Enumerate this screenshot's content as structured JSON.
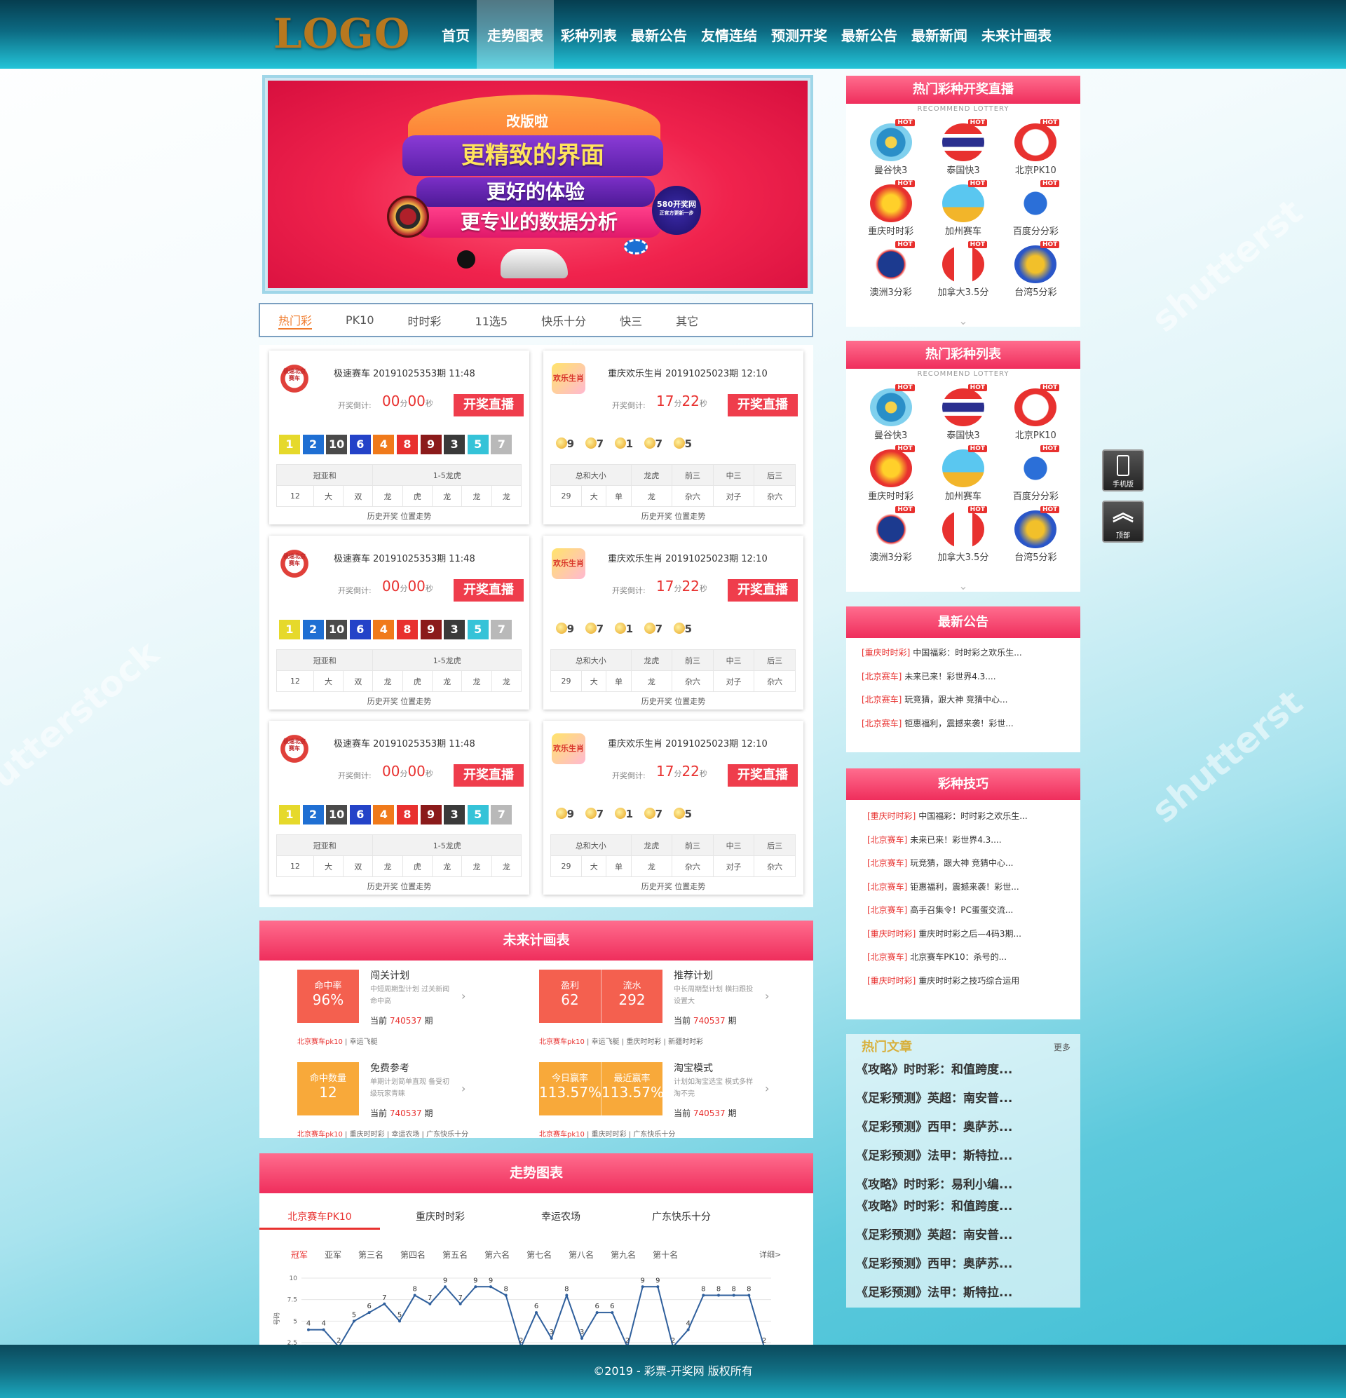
{
  "header": {
    "logo": "LOGO",
    "nav": [
      "首页",
      "走势图表",
      "彩种列表",
      "最新公告",
      "友情连结",
      "预测开奖",
      "最新公告",
      "最新新闻",
      "未来计画表"
    ],
    "active_index": 1
  },
  "banner": {
    "tag": "改版啦",
    "line1": "更精致的界面",
    "line2": "更好的体验",
    "line3": "更专业的数据分析",
    "brand": "580开奖网",
    "brand_sub": "正官方更新一步"
  },
  "lottery_tabs": [
    "热门彩",
    "PK10",
    "时时彩",
    "11选5",
    "快乐十分",
    "快三",
    "其它"
  ],
  "cards": {
    "left": {
      "logo_text": "极速北京赛车",
      "title": "极速赛车 20191025353期   11:48",
      "countdown_label": "开奖倒计:",
      "countdown_min": "00",
      "countdown_sec": "00",
      "unit_min": "分",
      "unit_sec": "秒",
      "live": "开奖直播",
      "balls": [
        "1",
        "2",
        "10",
        "6",
        "4",
        "8",
        "9",
        "3",
        "5",
        "7"
      ],
      "ball_colors": [
        "#e6d92b",
        "#1f6fd3",
        "#4a4a4a",
        "#2443c8",
        "#f07a1b",
        "#e8312f",
        "#8b1a1a",
        "#3a3a3a",
        "#35c3d8",
        "#b9b9b9"
      ],
      "head1": "冠亚和",
      "head2": "1-5龙虎",
      "row": [
        "12",
        "大",
        "双",
        "龙",
        "虎",
        "龙",
        "龙",
        "龙"
      ],
      "links": "历史开奖   位置走势"
    },
    "right": {
      "logo_text": "欢乐生肖",
      "title": "重庆欢乐生肖 20191025023期   12:10",
      "countdown_label": "开奖倒计:",
      "countdown_min": "17",
      "countdown_sec": "22",
      "unit_min": "分",
      "unit_sec": "秒",
      "live": "开奖直播",
      "balls": [
        "9",
        "7",
        "1",
        "7",
        "5"
      ],
      "heads": [
        "总和大小",
        "龙虎",
        "前三",
        "中三",
        "后三"
      ],
      "row": [
        "29",
        "大",
        "单",
        "龙",
        "杂六",
        "对子",
        "杂六"
      ],
      "links": "历史开奖   位置走势"
    }
  },
  "hot_live": {
    "title": "热门彩种开奖直播",
    "sub": "RECOMMEND LOTTERY",
    "items": [
      "曼谷快3",
      "泰国快3",
      "北京PK10",
      "重庆时时彩",
      "加州赛车",
      "百度分分彩",
      "澳洲3分彩",
      "加拿大3.5分",
      "台湾5分彩"
    ],
    "hot": "HOT"
  },
  "hot_list": {
    "title": "热门彩种列表",
    "sub": "RECOMMEND LOTTERY"
  },
  "notice": {
    "title": "最新公告",
    "items": [
      {
        "tag": "[重庆时时彩]",
        "text": "中国福彩：时时彩之欢乐生..."
      },
      {
        "tag": "[北京赛车]",
        "text": "未来已来！彩世界4.3...."
      },
      {
        "tag": "[北京赛车]",
        "text": "玩竞猜，跟大神 竞猜中心..."
      },
      {
        "tag": "[北京赛车]",
        "text": "钜惠福利，震撼来袭！彩世..."
      }
    ]
  },
  "tips": {
    "title": "彩种技巧",
    "items": [
      {
        "tag": "[重庆时时彩]",
        "text": "中国福彩：时时彩之欢乐生..."
      },
      {
        "tag": "[北京赛车]",
        "text": "未来已来！彩世界4.3...."
      },
      {
        "tag": "[北京赛车]",
        "text": "玩竞猜，跟大神 竞猜中心..."
      },
      {
        "tag": "[北京赛车]",
        "text": "钜惠福利，震撼来袭！彩世..."
      },
      {
        "tag": "[北京赛车]",
        "text": "高手召集令！PC蛋蛋交流..."
      },
      {
        "tag": "[重庆时时彩]",
        "text": "重庆时时彩之后—4码3期..."
      },
      {
        "tag": "[北京赛车]",
        "text": "北京赛车PK10：杀号的..."
      },
      {
        "tag": "[重庆时时彩]",
        "text": "重庆时时彩之技巧综合运用"
      }
    ]
  },
  "side_buttons": {
    "mobile": "手机版",
    "top": "顶部"
  },
  "hot_articles": {
    "title": "热门文章",
    "more": "更多",
    "items": [
      "《攻略》时时彩：和值跨度...",
      "《足彩预测》英超：南安普...",
      "《足彩预测》西甲：奥萨苏...",
      "《足彩预测》法甲：斯特拉...",
      "《攻略》时时彩：易利小编...",
      "《攻略》时时彩：和值跨度...",
      "《足彩预测》英超：南安普...",
      "《足彩预测》西甲：奥萨苏...",
      "《足彩预测》法甲：斯特拉..."
    ]
  },
  "plan": {
    "title": "未来计画表",
    "items": [
      {
        "boxes": [
          {
            "k": "命中率",
            "v": "96%"
          }
        ],
        "color": "#f4604f",
        "name": "闯关计划",
        "desc": "中短周期型计划 过关新闻命中高",
        "period_label": "当前",
        "period": "740537",
        "period_unit": "期",
        "tags": [
          {
            "t": "北京赛车pk10",
            "red": true
          },
          {
            "t": "幸运飞艇",
            "red": false
          }
        ]
      },
      {
        "boxes": [
          {
            "k": "盈利",
            "v": "62"
          },
          {
            "k": "流水",
            "v": "292"
          }
        ],
        "color": "#f4604f",
        "name": "推荐计划",
        "desc": "中长周期型计划 横扫跟投设置大",
        "period_label": "当前",
        "period": "740537",
        "period_unit": "期",
        "tags": [
          {
            "t": "北京赛车pk10",
            "red": true
          },
          {
            "t": "幸运飞艇",
            "red": false
          },
          {
            "t": "重庆时时彩",
            "red": false
          },
          {
            "t": "新疆时时彩",
            "red": false
          }
        ]
      },
      {
        "boxes": [
          {
            "k": "命中数量",
            "v": "12"
          }
        ],
        "color": "#f8a93a",
        "name": "免费参考",
        "desc": "单期计划简单直观 备受初级玩家青睐",
        "period_label": "当前",
        "period": "740537",
        "period_unit": "期",
        "tags": [
          {
            "t": "北京赛车pk10",
            "red": true
          },
          {
            "t": "重庆时时彩",
            "red": false
          },
          {
            "t": "幸运农场",
            "red": false
          },
          {
            "t": "广东快乐十分",
            "red": false
          }
        ]
      },
      {
        "boxes": [
          {
            "k": "今日赢率",
            "v": "113.57%"
          },
          {
            "k": "最近赢率",
            "v": "113.57%"
          }
        ],
        "color": "#f8a93a",
        "name": "淘宝模式",
        "desc": "计划如淘宝选宝 模式多样淘不完",
        "period_label": "当前",
        "period": "740537",
        "period_unit": "期",
        "tags": [
          {
            "t": "北京赛车pk10",
            "red": true
          },
          {
            "t": "重庆时时彩",
            "red": false
          },
          {
            "t": "广东快乐十分",
            "red": false
          }
        ]
      }
    ]
  },
  "trend": {
    "title": "走势图表",
    "tabs": [
      "北京赛车PK10",
      "重庆时时彩",
      "幸运农场",
      "广东快乐十分"
    ],
    "ranks": [
      "冠军",
      "亚军",
      "第三名",
      "第四名",
      "第五名",
      "第六名",
      "第七名",
      "第八名",
      "第九名",
      "第十名"
    ],
    "detail": "详细>"
  },
  "chart_data": {
    "type": "line",
    "title": "",
    "xlabel": "",
    "ylabel": "号码",
    "ylim": [
      2.5,
      10
    ],
    "yticks": [
      "10",
      "7.5",
      "5",
      "2.5"
    ],
    "series": [
      {
        "values": [
          4,
          4,
          2,
          5,
          6,
          7,
          5,
          8,
          7,
          9,
          7,
          9,
          9,
          8,
          2,
          6,
          3,
          8,
          3,
          6,
          6,
          2,
          9,
          9,
          2,
          4,
          8,
          8,
          8,
          8,
          2
        ]
      }
    ],
    "line_color": "#2f5f9c"
  },
  "footer": {
    "text": "©2019 - 彩票-开奖网 版权所有"
  }
}
